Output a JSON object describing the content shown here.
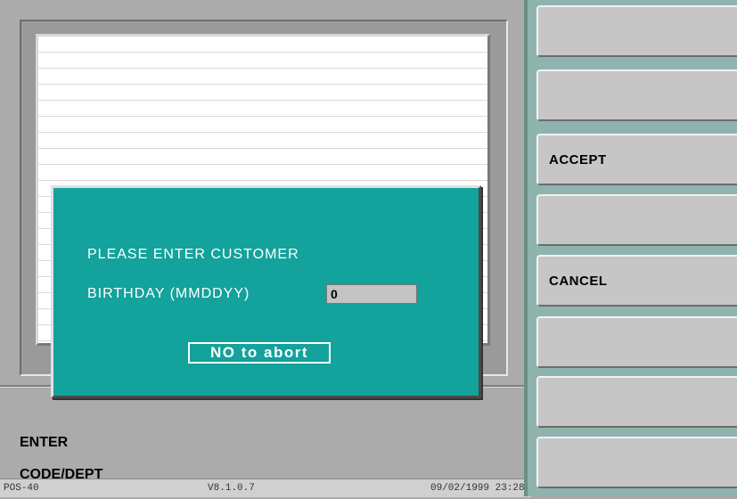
{
  "prompt": {
    "line1": "ENTER",
    "line2": "CODE/DEPT"
  },
  "status_bar": {
    "terminal": "POS-40",
    "version": "V8.1.0.7",
    "datetime": "09/02/1999 23:28"
  },
  "dialog": {
    "line1": "PLEASE ENTER CUSTOMER",
    "line2": "BIRTHDAY (MMDDYY)",
    "input_value": "0",
    "abort_button": "NO to abort"
  },
  "side_buttons": [
    {
      "label": ""
    },
    {
      "label": ""
    },
    {
      "label": "ACCEPT"
    },
    {
      "label": ""
    },
    {
      "label": "CANCEL"
    },
    {
      "label": ""
    },
    {
      "label": ""
    },
    {
      "label": ""
    }
  ],
  "colors": {
    "dialog_bg": "#13a29c",
    "panel_bg": "#8fb4ad",
    "button_bg": "#c6c6c6"
  }
}
